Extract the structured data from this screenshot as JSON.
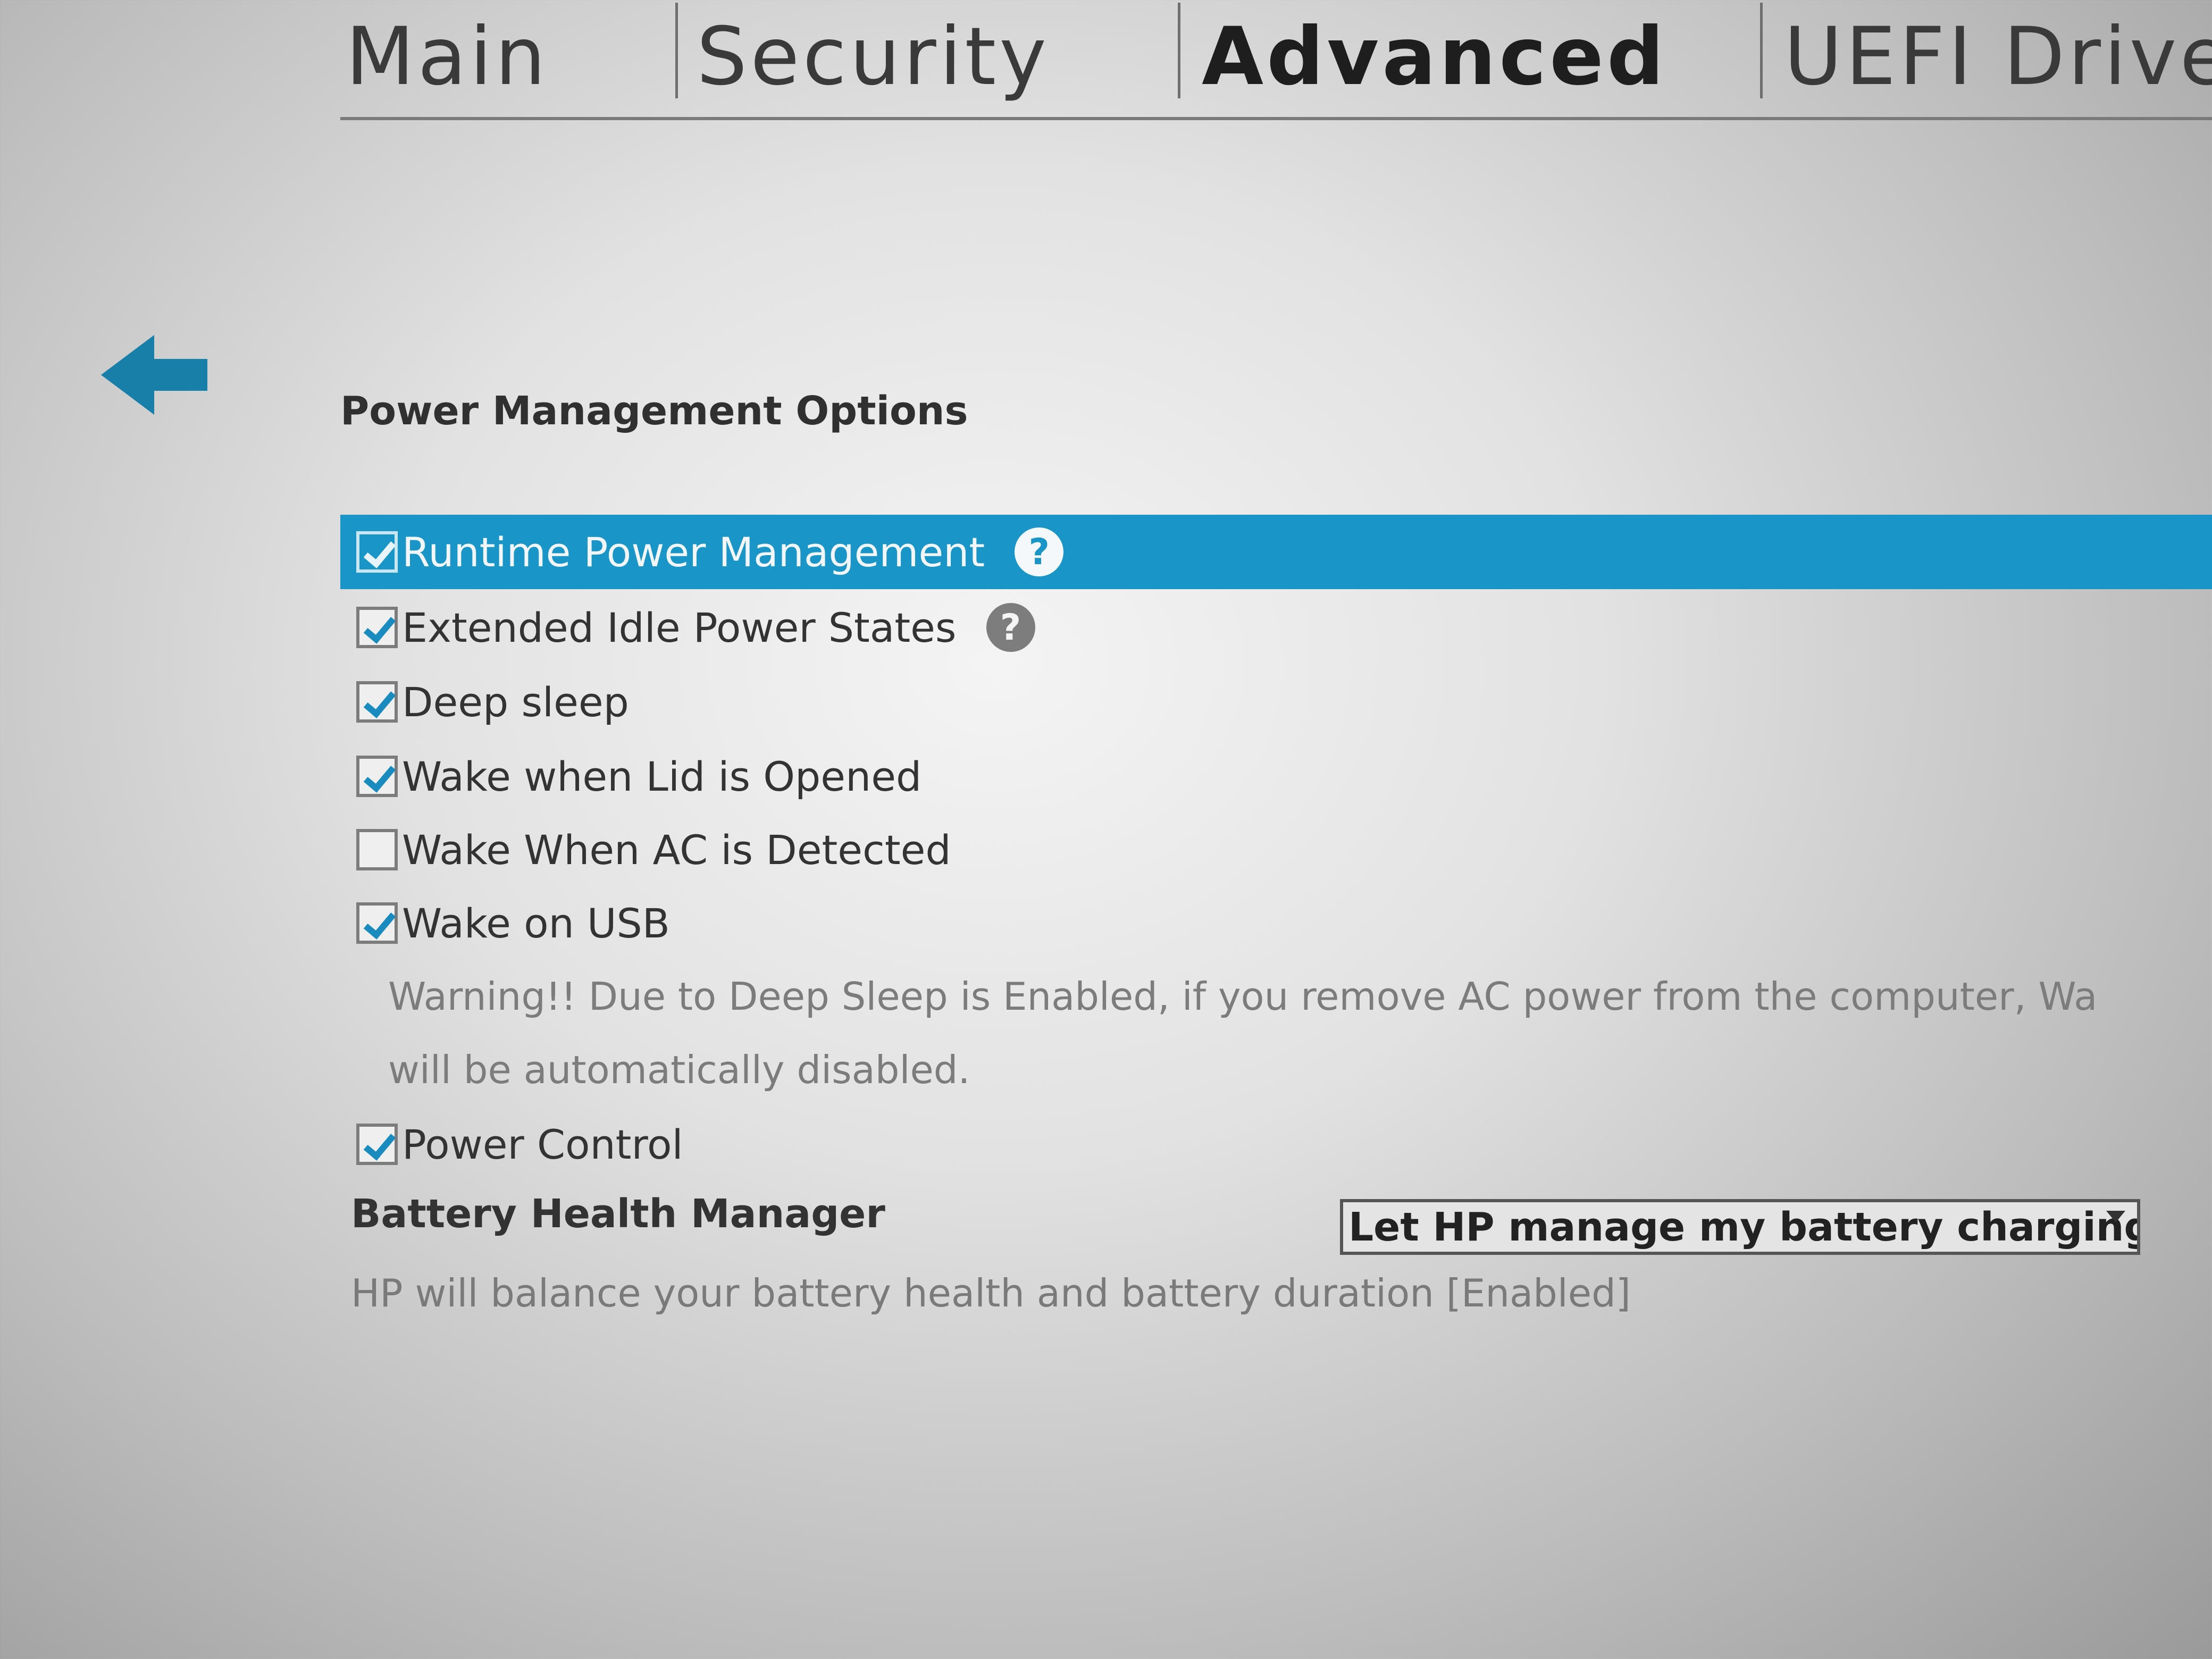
{
  "tabs": [
    {
      "label": "Main"
    },
    {
      "label": "Security"
    },
    {
      "label": "Advanced"
    },
    {
      "label": "UEFI Drive"
    }
  ],
  "active_tab": "Advanced",
  "icons": {
    "back": "back-arrow-icon",
    "help": "help-icon",
    "dropdown": "chevron-down-icon"
  },
  "colors": {
    "selection": "#1a95c8",
    "back_arrow": "#177fa8"
  },
  "section": {
    "title": "Power Management Options"
  },
  "options": [
    {
      "label": "Runtime Power Management",
      "checked": true,
      "help": "?"
    },
    {
      "label": "Extended Idle Power States",
      "checked": true,
      "help": "?"
    },
    {
      "label": "Deep sleep",
      "checked": true
    },
    {
      "label": "Wake when Lid is Opened",
      "checked": true
    },
    {
      "label": "Wake When AC is Detected",
      "checked": false
    },
    {
      "label": "Wake on USB",
      "checked": true
    }
  ],
  "warning": {
    "line1": "Warning!! Due to Deep Sleep is Enabled, if you remove AC power from the computer, Wa",
    "line2": "will be automatically disabled."
  },
  "power_control": {
    "label": "Power Control",
    "checked": true
  },
  "battery": {
    "label": "Battery Health Manager",
    "selected": "Let HP manage my battery charging",
    "description": "HP will balance your battery health and battery duration [Enabled]"
  }
}
